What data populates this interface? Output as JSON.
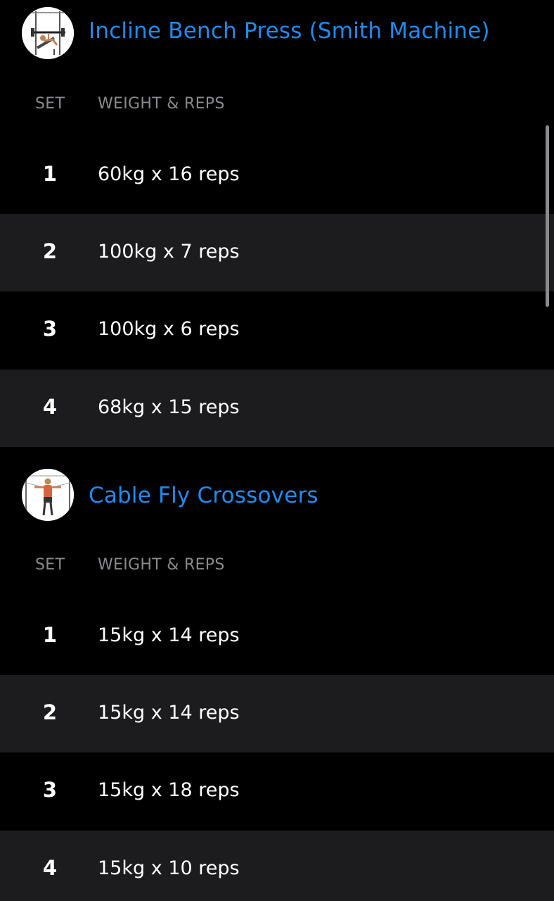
{
  "exercises": [
    {
      "title": "Incline Bench Press (Smith Machine)",
      "thumbnail_icon": "incline-bench-press-illustration",
      "headers": {
        "set": "SET",
        "weight_reps": "WEIGHT & REPS"
      },
      "sets": [
        {
          "num": "1",
          "value": "60kg x 16 reps"
        },
        {
          "num": "2",
          "value": "100kg x 7 reps"
        },
        {
          "num": "3",
          "value": "100kg x 6 reps"
        },
        {
          "num": "4",
          "value": "68kg x 15 reps"
        }
      ]
    },
    {
      "title": "Cable Fly Crossovers",
      "thumbnail_icon": "cable-fly-illustration",
      "headers": {
        "set": "SET",
        "weight_reps": "WEIGHT & REPS"
      },
      "sets": [
        {
          "num": "1",
          "value": "15kg x 14 reps"
        },
        {
          "num": "2",
          "value": "15kg x 14 reps"
        },
        {
          "num": "3",
          "value": "15kg x 18 reps"
        },
        {
          "num": "4",
          "value": "15kg x 10 reps"
        }
      ]
    }
  ],
  "colors": {
    "background": "#000000",
    "alt_row": "#1c1c1e",
    "accent": "#1e8cf0",
    "muted": "#8a8a8e"
  }
}
